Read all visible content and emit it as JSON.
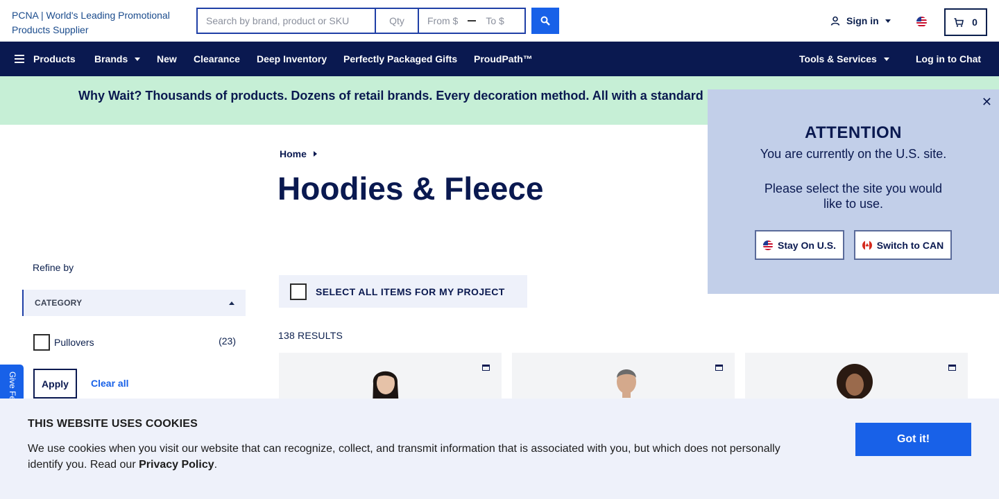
{
  "header": {
    "logo_alt": "PCNA | World's Leading Promotional Products Supplier",
    "search": {
      "placeholder": "Search by brand, product or SKU",
      "qty_placeholder": "Qty",
      "from_placeholder": "From $",
      "to_placeholder": "To $"
    },
    "signin_label": "Sign in",
    "cart_count": "0"
  },
  "nav": {
    "products": "Products",
    "brands": "Brands",
    "new": "New",
    "clearance": "Clearance",
    "deep_inventory": "Deep Inventory",
    "perfectly_packaged": "Perfectly Packaged Gifts",
    "proudpath": "ProudPath™",
    "tools": "Tools & Services",
    "chat": "Log in to Chat"
  },
  "promo": {
    "text": "Why Wait? Thousands of products. Dozens of retail brands. Every decoration method. All with a standard"
  },
  "breadcrumb": {
    "home": "Home"
  },
  "page_title": "Hoodies & Fleece",
  "sidebar": {
    "refine_label": "Refine by",
    "category_header": "CATEGORY",
    "filters": [
      {
        "name": "Pullovers",
        "count": "(23)"
      }
    ],
    "apply_label": "Apply",
    "clear_label": "Clear all"
  },
  "feedback_label": "Give Fe",
  "listing": {
    "select_all_label": "SELECT ALL ITEMS FOR MY PROJECT",
    "results_label": "138 RESULTS"
  },
  "site_popup": {
    "title": "ATTENTION",
    "line1": "You are currently on the U.S. site.",
    "line2": "Please select the site you would like to use.",
    "stay_label": "Stay On U.S.",
    "switch_label": "Switch to CAN"
  },
  "cookie": {
    "title": "THIS WEBSITE USES COOKIES",
    "body_before": "We use cookies when you visit our website that can recognize, collect, and transmit information that is associated with you, but which does not personally identify you. Read our ",
    "privacy_link": "Privacy Policy",
    "body_after": ".",
    "accept_label": "Got it!"
  },
  "colors": {
    "navy": "#0a1950",
    "accent_blue": "#1861e8",
    "promo_green": "#c6efd6",
    "popup_blue": "#c2cfe9",
    "panel_gray": "#eef1fa"
  },
  "icons": [
    "hamburger-icon",
    "search-icon",
    "user-icon",
    "us-flag-icon",
    "cart-icon",
    "close-icon",
    "folder-icon",
    "ca-flag-icon"
  ]
}
